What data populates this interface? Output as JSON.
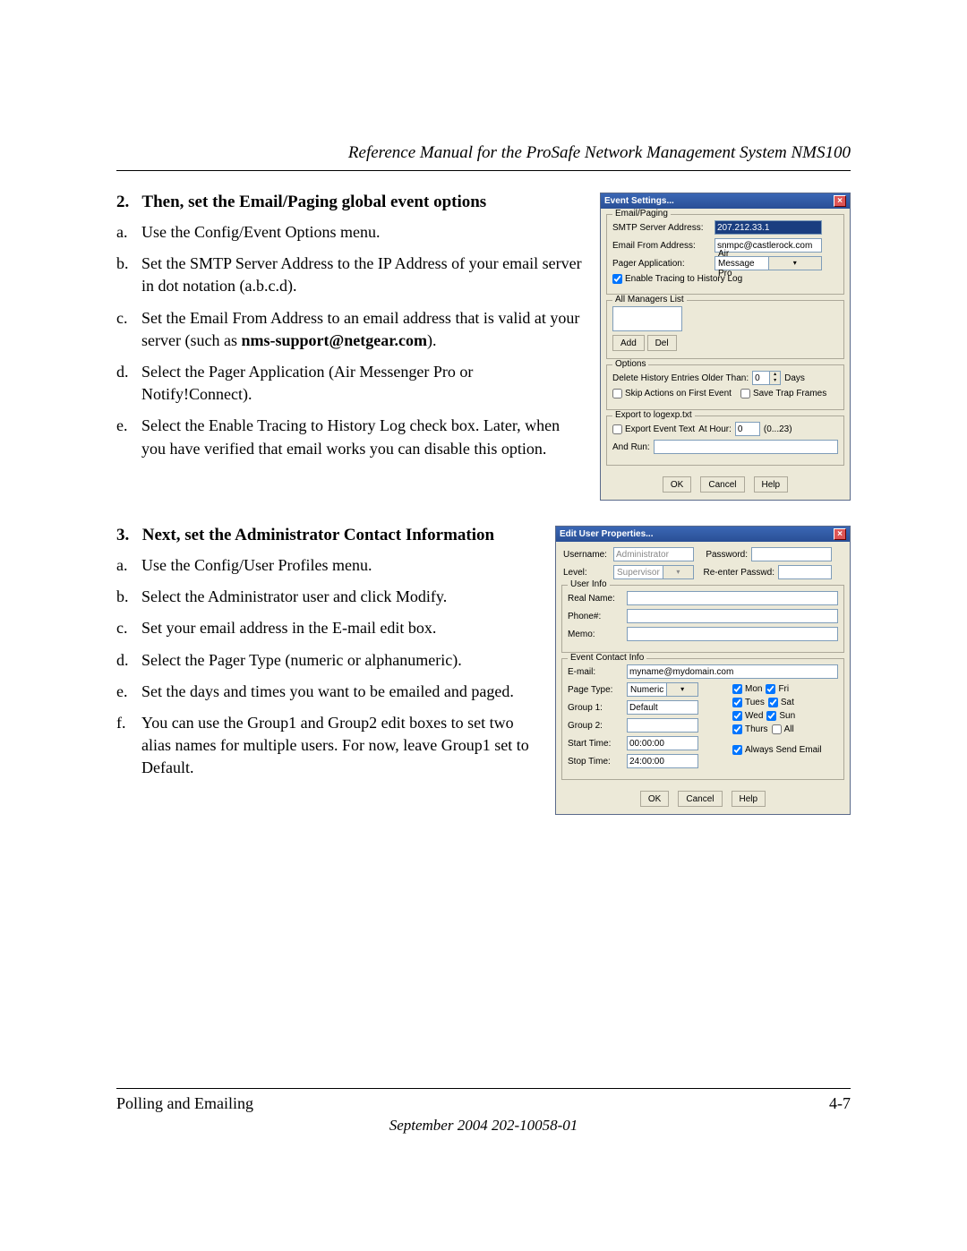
{
  "header": {
    "title": "Reference Manual for the ProSafe Network Management System NMS100"
  },
  "sections": [
    {
      "num": "2.",
      "title": "Then, set the Email/Paging global event options",
      "items": [
        {
          "l": "a.",
          "t": "Use the Config/Event Options menu."
        },
        {
          "l": "b.",
          "t": "Set the SMTP Server Address to the IP Address of your email server in dot notation (a.b.c.d)."
        },
        {
          "l": "c.",
          "t_pre": "Set the Email From Address to an email address that is valid at your server (such as ",
          "bold": "nms-support@netgear.com",
          "t_post": ")."
        },
        {
          "l": "d.",
          "t": "Select the Pager Application (Air Messenger Pro or Notify!Connect)."
        },
        {
          "l": "e.",
          "t": "Select the Enable Tracing to History Log check box. Later, when you have verified that email works you can disable this option."
        }
      ]
    },
    {
      "num": "3.",
      "title": "Next, set the Administrator Contact Information",
      "items": [
        {
          "l": "a.",
          "t": "Use the Config/User Profiles menu."
        },
        {
          "l": "b.",
          "t": "Select the Administrator user and click Modify."
        },
        {
          "l": "c.",
          "t": "Set your email address in the E-mail edit box."
        },
        {
          "l": "d.",
          "t": "Select the Pager Type (numeric or alphanumeric)."
        },
        {
          "l": "e.",
          "t": "Set the days and times you want to be emailed and paged."
        },
        {
          "l": "f.",
          "t": "You can use the Group1 and Group2 edit boxes to set two alias names for multiple users. For now, leave Group1 set to Default."
        }
      ]
    }
  ],
  "dlg1": {
    "title": "Event Settings...",
    "grp_email": "Email/Paging",
    "smtp_label": "SMTP Server Address:",
    "smtp_value": "207.212.33.1",
    "from_label": "Email From Address:",
    "from_value": "snmpc@castlerock.com",
    "pager_label": "Pager Application:",
    "pager_value": "Air Message Pro",
    "enable_trace": "Enable Tracing to History Log",
    "grp_mgrs": "All Managers List",
    "add": "Add",
    "del": "Del",
    "grp_opts": "Options",
    "del_hist": "Delete History Entries Older Than:",
    "del_hist_val": "0",
    "days": "Days",
    "skip_first": "Skip Actions on First Event",
    "save_trap": "Save Trap Frames",
    "grp_export": "Export to logexp.txt",
    "export_text": "Export Event Text",
    "at_hour": "At Hour:",
    "at_hour_val": "0",
    "at_hour_range": "(0...23)",
    "and_run": "And Run:",
    "ok": "OK",
    "cancel": "Cancel",
    "help": "Help"
  },
  "dlg2": {
    "title": "Edit User Properties...",
    "username_l": "Username:",
    "username_v": "Administrator",
    "password_l": "Password:",
    "level_l": "Level:",
    "level_v": "Supervisor",
    "reenter_l": "Re-enter Passwd:",
    "grp_userinfo": "User Info",
    "realname_l": "Real Name:",
    "phone_l": "Phone#:",
    "memo_l": "Memo:",
    "grp_contact": "Event Contact Info",
    "email_l": "E-mail:",
    "email_v": "myname@mydomain.com",
    "pagetype_l": "Page Type:",
    "pagetype_v": "Numeric",
    "group1_l": "Group 1:",
    "group1_v": "Default",
    "group2_l": "Group 2:",
    "start_l": "Start Time:",
    "start_v": "00:00:00",
    "stop_l": "Stop Time:",
    "stop_v": "24:00:00",
    "days": {
      "mon": "Mon",
      "tue": "Tues",
      "wed": "Wed",
      "thu": "Thurs",
      "fri": "Fri",
      "sat": "Sat",
      "sun": "Sun",
      "all": "All"
    },
    "always_send": "Always Send Email",
    "ok": "OK",
    "cancel": "Cancel",
    "help": "Help"
  },
  "footer": {
    "left": "Polling and Emailing",
    "right": "4-7",
    "date": "September 2004 202-10058-01"
  }
}
